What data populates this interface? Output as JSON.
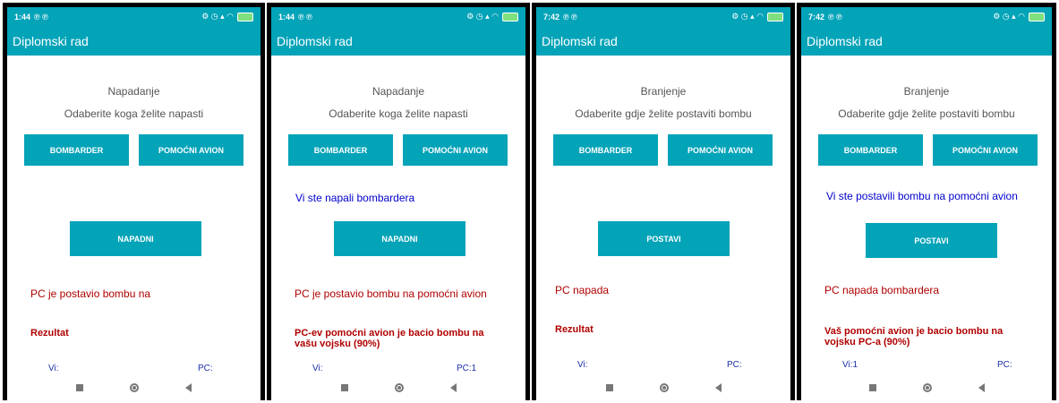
{
  "app_title": "Diplomski rad",
  "phones": [
    {
      "time": "1:44",
      "heading": "Napadanje",
      "subheading": "Odaberite koga želite napasti",
      "option1": "BOMBARDER",
      "option2": "POMOĆNI AVION",
      "selected_text": "",
      "action": "NAPADNI",
      "pc_message": "PC je postavio bombu na",
      "result": "Rezultat",
      "score_you": "Vi:",
      "score_pc": "PC:"
    },
    {
      "time": "1:44",
      "heading": "Napadanje",
      "subheading": "Odaberite koga želite napasti",
      "option1": "BOMBARDER",
      "option2": "POMOĆNI AVION",
      "selected_text": "Vi ste napali bombardera",
      "action": "NAPADNI",
      "pc_message": "PC je postavio bombu na pomoćni avion",
      "result": "PC-ev pomoćni avion je bacio bombu na vašu vojsku (90%)",
      "score_you": "Vi:",
      "score_pc": "PC:1"
    },
    {
      "time": "7:42",
      "heading": "Branjenje",
      "subheading": "Odaberite gdje želite postaviti bombu",
      "option1": "BOMBARDER",
      "option2": "POMOĆNI AVION",
      "selected_text": "",
      "action": "POSTAVI",
      "pc_message": "PC napada",
      "result": "Rezultat",
      "score_you": "Vi:",
      "score_pc": "PC:"
    },
    {
      "time": "7:42",
      "heading": "Branjenje",
      "subheading": "Odaberite gdje želite postaviti bombu",
      "option1": "BOMBARDER",
      "option2": "POMOĆNI AVION",
      "selected_text": "Vi ste postavili bombu na pomoćni avion",
      "action": "POSTAVI",
      "pc_message": "PC napada bombardera",
      "result": "Vaš pomoćni avion je bacio bombu na vojsku PC-a (90%)",
      "score_you": "Vi:1",
      "score_pc": "PC:"
    }
  ],
  "colors": {
    "accent": "#03a3b8",
    "result_red": "#b00000",
    "info_blue": "#0000cc"
  }
}
